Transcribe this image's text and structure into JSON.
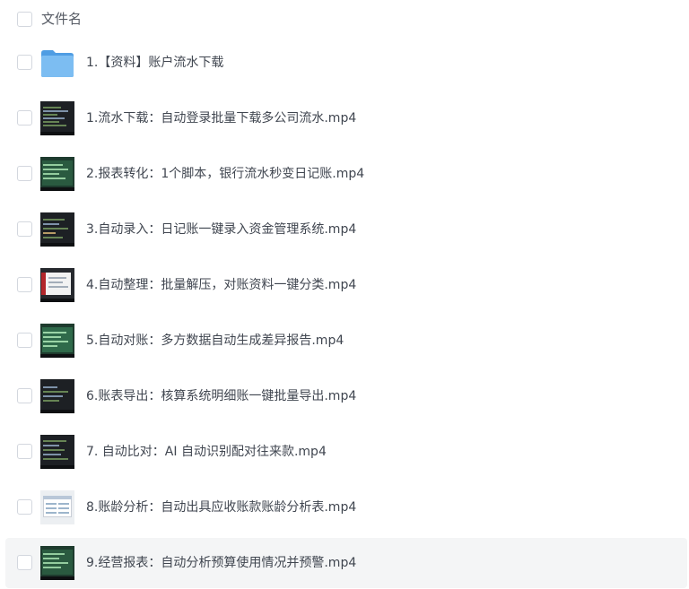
{
  "header": {
    "label": "文件名"
  },
  "colors": {
    "folder": "#6fb6f0",
    "folder_back": "#4f9de3",
    "hover_row": "#f4f5f6",
    "checkbox_border": "#d3d7de",
    "text": "#404650"
  },
  "files": [
    {
      "name": "1.【资料】账户流水下载",
      "icon": "folder-icon"
    },
    {
      "name": "1.流水下载：自动登录批量下载多公司流水.mp4",
      "icon": "video-thumbnail"
    },
    {
      "name": "2.报表转化：1个脚本，银行流水秒变日记账.mp4",
      "icon": "video-thumbnail"
    },
    {
      "name": "3.自动录入：日记账一键录入资金管理系统.mp4",
      "icon": "video-thumbnail"
    },
    {
      "name": "4.自动整理：批量解压，对账资料一键分类.mp4",
      "icon": "video-thumbnail"
    },
    {
      "name": "5.自动对账：多方数据自动生成差异报告.mp4",
      "icon": "video-thumbnail"
    },
    {
      "name": "6.账表导出：核算系统明细账一键批量导出.mp4",
      "icon": "video-thumbnail"
    },
    {
      "name": "7. 自动比对：AI 自动识别配对往来款.mp4",
      "icon": "video-thumbnail"
    },
    {
      "name": "8.账龄分析：自动出具应收账款账龄分析表.mp4",
      "icon": "video-thumbnail"
    },
    {
      "name": "9.经营报表：自动分析预算使用情况并预警.mp4",
      "icon": "video-thumbnail"
    }
  ]
}
